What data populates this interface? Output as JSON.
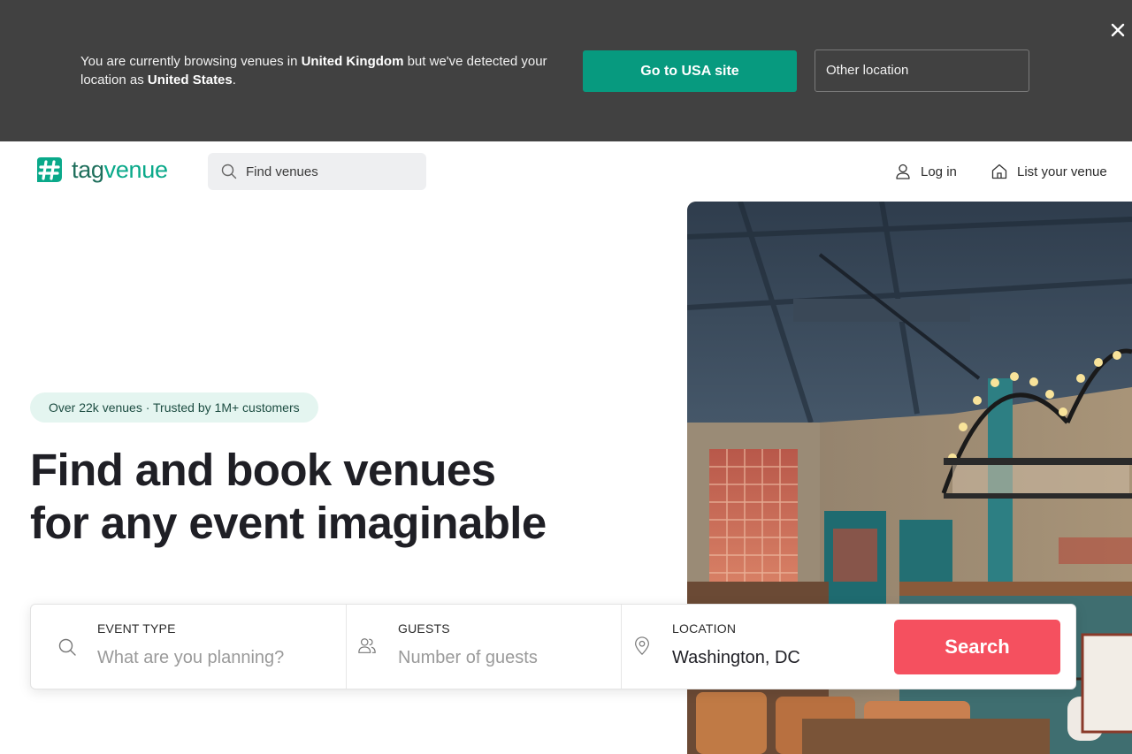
{
  "banner": {
    "text_prefix": "You are currently browsing venues in ",
    "current_country": "United Kingdom",
    "text_middle": " but we've detected your location as ",
    "detected_country": "United States",
    "text_suffix": ".",
    "primary_button": "Go to USA site",
    "secondary_button": "Other location",
    "close_icon": "close-icon"
  },
  "header": {
    "logo_part1": "tag",
    "logo_part2": "venue",
    "search_placeholder": "Find venues",
    "login_label": "Log in",
    "list_venue_label": "List your venue"
  },
  "hero": {
    "pill_text": "Over 22k venues  ·  Trusted by 1M+ customers",
    "title_line1": "Find and book venues",
    "title_line2": "for any event imaginable"
  },
  "search": {
    "event_label": "EVENT TYPE",
    "event_placeholder": "What are you planning?",
    "guests_label": "GUESTS",
    "guests_placeholder": "Number of guests",
    "location_label": "LOCATION",
    "location_value": "Washington, DC",
    "button_label": "Search"
  },
  "colors": {
    "banner_bg": "#414141",
    "brand_green": "#079a7f",
    "search_red": "#f5505f",
    "pill_bg": "#e4f5f0"
  }
}
